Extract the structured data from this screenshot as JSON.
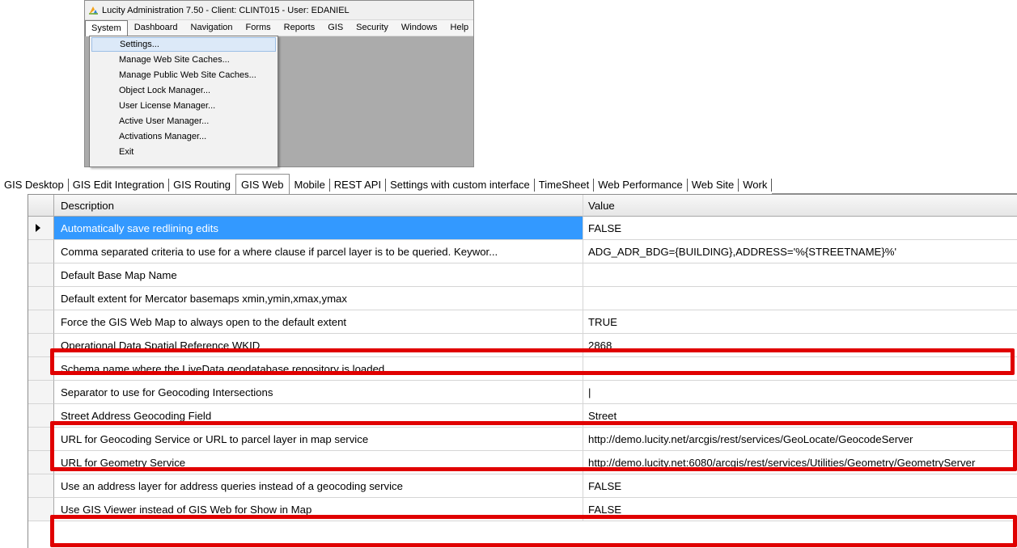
{
  "window": {
    "title": "Lucity Administration 7.50 - Client: CLINT015 - User: EDANIEL",
    "menu": [
      "System",
      "Dashboard",
      "Navigation",
      "Forms",
      "Reports",
      "GIS",
      "Security",
      "Windows",
      "Help"
    ],
    "active_menu": "System",
    "dropdown": [
      "Settings...",
      "Manage Web Site Caches...",
      "Manage Public Web Site Caches...",
      "Object Lock Manager...",
      "User License Manager...",
      "Active User Manager...",
      "Activations Manager...",
      "Exit"
    ],
    "highlighted_item": "Settings..."
  },
  "tabs": [
    "GIS Desktop",
    "GIS Edit Integration",
    "GIS Routing",
    "GIS Web",
    "Mobile",
    "REST API",
    "Settings with custom interface",
    "TimeSheet",
    "Web Performance",
    "Web Site",
    "Work"
  ],
  "active_tab": "GIS Web",
  "grid": {
    "headers": {
      "description": "Description",
      "value": "Value"
    },
    "rows": [
      {
        "description": "Automatically save redlining edits",
        "value": "FALSE",
        "selected": true,
        "highlighted": false
      },
      {
        "description": "Comma separated criteria to use for a where clause if parcel layer is to be queried.  Keywor...",
        "value": "ADG_ADR_BDG={BUILDING},ADDRESS='%{STREETNAME}%'",
        "selected": false,
        "highlighted": false
      },
      {
        "description": "Default Base Map Name",
        "value": "",
        "selected": false,
        "highlighted": false
      },
      {
        "description": "Default extent for Mercator basemaps xmin,ymin,xmax,ymax",
        "value": "",
        "selected": false,
        "highlighted": false
      },
      {
        "description": "Force the GIS Web Map to always open to the default extent",
        "value": "TRUE",
        "selected": false,
        "highlighted": false
      },
      {
        "description": "Operational Data Spatial Reference WKID",
        "value": "2868",
        "selected": false,
        "highlighted": true
      },
      {
        "description": "Schema name where the LiveData geodatabase repository is loaded",
        "value": "",
        "selected": false,
        "highlighted": false
      },
      {
        "description": "Separator to use for Geocoding Intersections",
        "value": "|",
        "selected": false,
        "highlighted": false
      },
      {
        "description": "Street Address Geocoding Field",
        "value": "Street",
        "selected": false,
        "highlighted": true
      },
      {
        "description": "URL for Geocoding Service or URL to parcel layer in map service",
        "value": "http://demo.lucity.net/arcgis/rest/services/GeoLocate/GeocodeServer",
        "selected": false,
        "highlighted": true
      },
      {
        "description": "URL for Geometry Service",
        "value": "http://demo.lucity.net:6080/arcgis/rest/services/Utilities/Geometry/GeometryServer",
        "selected": false,
        "highlighted": false
      },
      {
        "description": "Use an address layer for address queries instead of a geocoding service",
        "value": "FALSE",
        "selected": false,
        "highlighted": false
      },
      {
        "description": "Use GIS Viewer instead of GIS Web for Show in Map",
        "value": "FALSE",
        "selected": false,
        "highlighted": true
      }
    ]
  },
  "colors": {
    "highlight_box": "#e00000",
    "selected_row": "#3399ff",
    "workspace": "#ababab"
  },
  "icons": {
    "app": "lucity-logo-icon",
    "row_indicator": "row-pointer-icon"
  }
}
